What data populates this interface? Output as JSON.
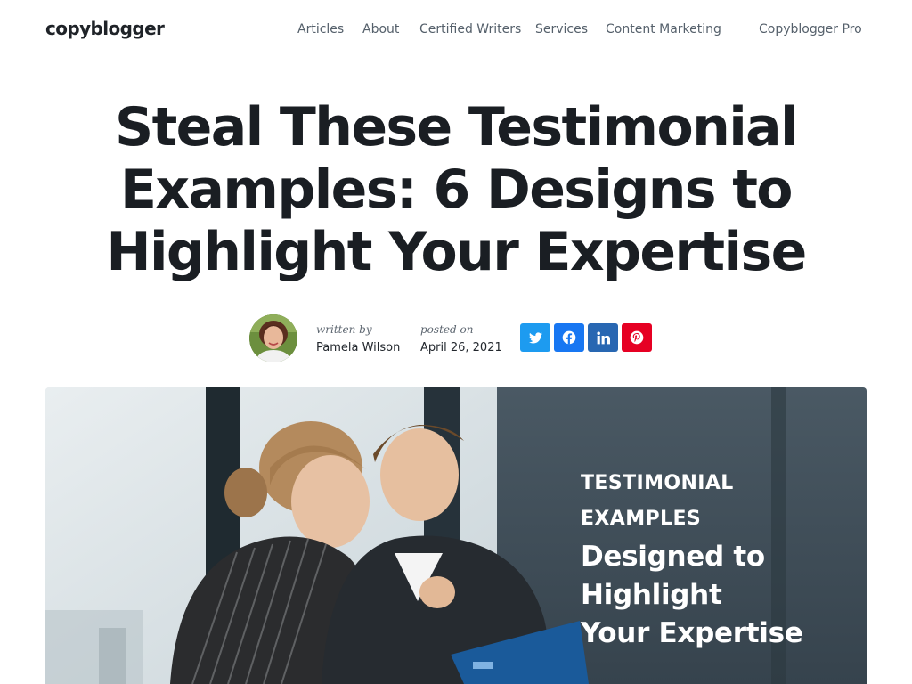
{
  "header": {
    "logo": "copyblogger",
    "nav": [
      {
        "label": "Articles"
      },
      {
        "label": "About"
      },
      {
        "label": "Certified Writers"
      },
      {
        "label": "Services"
      },
      {
        "label": "Content Marketing"
      },
      {
        "label": "Copyblogger Pro"
      }
    ]
  },
  "article": {
    "title": "Steal These Testimonial Examples: 6 Designs to Highlight Your Expertise",
    "byline": {
      "written_label": "written by",
      "author": "Pamela Wilson",
      "posted_label": "posted on",
      "date": "April 26, 2021"
    },
    "share": [
      {
        "icon": "twitter-icon",
        "color": "#1d9bf0"
      },
      {
        "icon": "facebook-icon",
        "color": "#1877f2"
      },
      {
        "icon": "linkedin-icon",
        "color": "#2867b2"
      },
      {
        "icon": "pinterest-icon",
        "color": "#e60023"
      }
    ],
    "hero": {
      "kicker_line1": "TESTIMONIAL",
      "kicker_line2": "EXAMPLES",
      "headline_line1": "Designed to",
      "headline_line2": "Highlight",
      "headline_line3": "Your Expertise",
      "panel_color": "#3f4d58"
    }
  }
}
